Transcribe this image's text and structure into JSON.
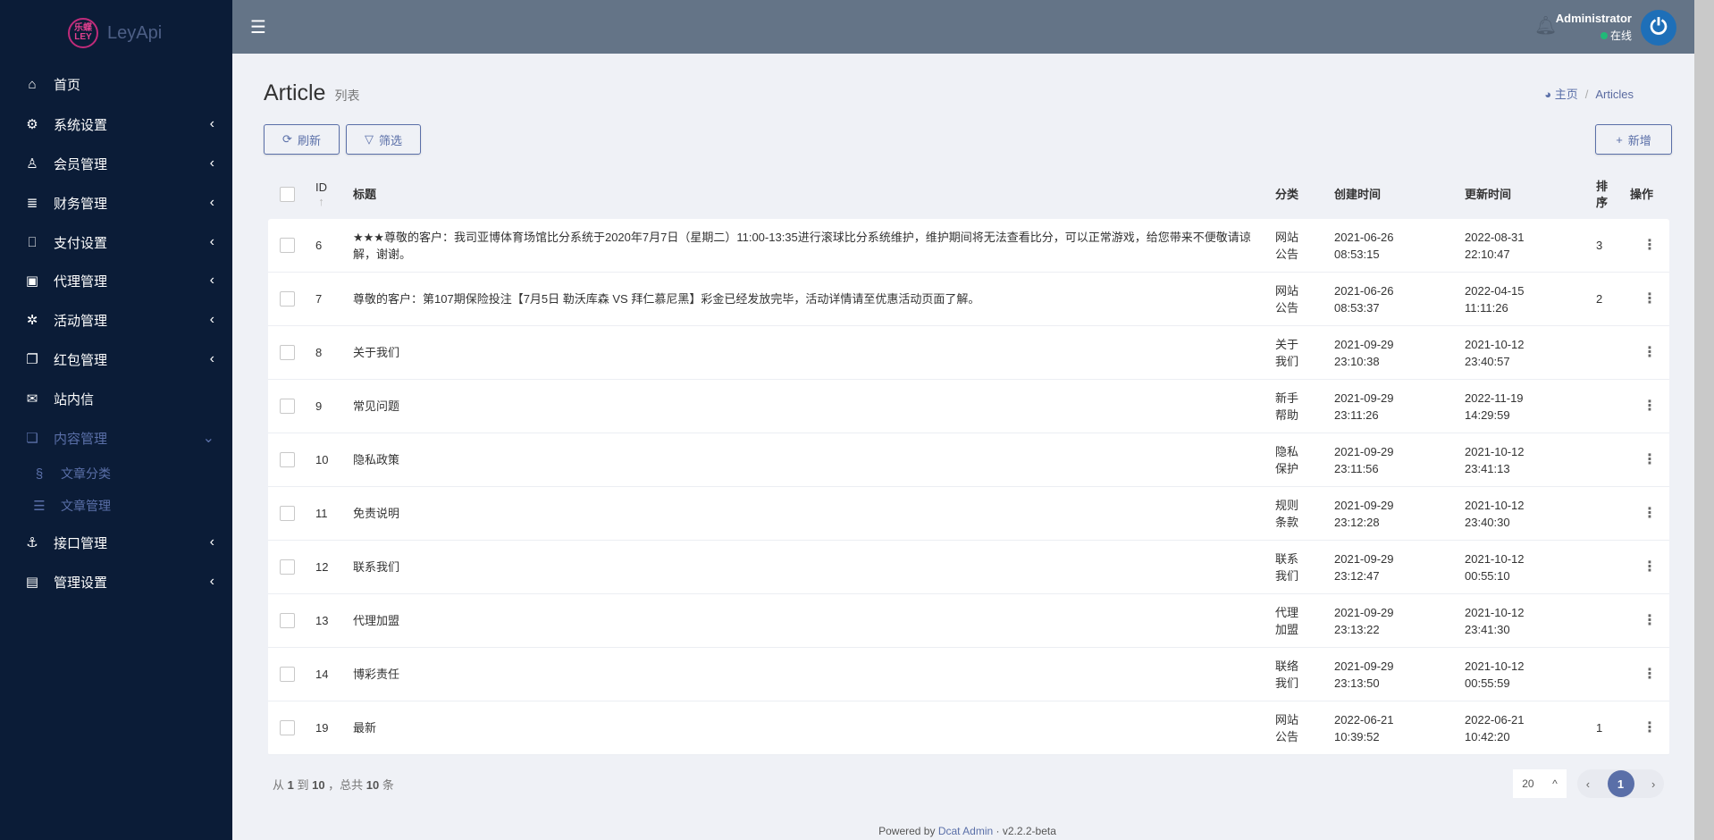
{
  "app": {
    "logo_mark": "乐蝶LEY",
    "name": "LeyApi"
  },
  "sidebar": {
    "items": [
      {
        "label": "首页",
        "icon": "home-icon",
        "glyph": "⌂",
        "chev": ""
      },
      {
        "label": "系统设置",
        "icon": "gears-icon",
        "glyph": "⚙",
        "chev": "‹"
      },
      {
        "label": "会员管理",
        "icon": "user-icon",
        "glyph": "♙",
        "chev": "‹"
      },
      {
        "label": "财务管理",
        "icon": "database-icon",
        "glyph": "≣",
        "chev": "‹"
      },
      {
        "label": "支付设置",
        "icon": "bookmark-icon",
        "glyph": "⎕",
        "chev": "‹"
      },
      {
        "label": "代理管理",
        "icon": "contact-icon",
        "glyph": "▣",
        "chev": "‹"
      },
      {
        "label": "活动管理",
        "icon": "pinwheel-icon",
        "glyph": "✲",
        "chev": "‹"
      },
      {
        "label": "红包管理",
        "icon": "clone-icon",
        "glyph": "❐",
        "chev": "‹"
      },
      {
        "label": "站内信",
        "icon": "envelope-icon",
        "glyph": "✉",
        "chev": ""
      },
      {
        "label": "内容管理",
        "icon": "copy-icon",
        "glyph": "❏",
        "chev": "⌄"
      },
      {
        "label": "文章分类",
        "icon": "category-icon",
        "glyph": "§",
        "chev": ""
      },
      {
        "label": "文章管理",
        "icon": "list-icon",
        "glyph": "☰",
        "chev": ""
      },
      {
        "label": "接口管理",
        "icon": "anchor-icon",
        "glyph": "⚓",
        "chev": "‹"
      },
      {
        "label": "管理设置",
        "icon": "id-card-icon",
        "glyph": "▤",
        "chev": "‹"
      }
    ]
  },
  "header": {
    "user_name": "Administrator",
    "status": "在线",
    "status_color": "#21b978"
  },
  "page": {
    "title": "Article",
    "subtitle": "列表",
    "breadcrumb_home": "主页",
    "breadcrumb_current": "Articles"
  },
  "toolbar": {
    "refresh": "刷新",
    "filter": "筛选",
    "create": "新增"
  },
  "table": {
    "headers": {
      "id": "ID",
      "title": "标题",
      "category": "分类",
      "created": "创建时间",
      "updated": "更新时间",
      "order": "排序",
      "actions": "操作"
    },
    "rows": [
      {
        "id": "6",
        "title": "★★★尊敬的客户：我司亚博体育场馆比分系统于2020年7月7日（星期二）11:00-13:35进行滚球比分系统维护，维护期间将无法查看比分，可以正常游戏，给您带来不便敬请谅解，谢谢。",
        "category": "网站公告",
        "created": "2021-06-26 08:53:15",
        "updated": "2022-08-31 22:10:47",
        "order": "3"
      },
      {
        "id": "7",
        "title": "尊敬的客户：第107期保险投注【7月5日 勒沃库森 VS 拜仁慕尼黑】彩金已经发放完毕，活动详情请至优惠活动页面了解。",
        "category": "网站公告",
        "created": "2021-06-26 08:53:37",
        "updated": "2022-04-15 11:11:26",
        "order": "2"
      },
      {
        "id": "8",
        "title": "关于我们",
        "category": "关于我们",
        "created": "2021-09-29 23:10:38",
        "updated": "2021-10-12 23:40:57",
        "order": ""
      },
      {
        "id": "9",
        "title": "常见问题",
        "category": "新手帮助",
        "created": "2021-09-29 23:11:26",
        "updated": "2022-11-19 14:29:59",
        "order": ""
      },
      {
        "id": "10",
        "title": "隐私政策",
        "category": "隐私保护",
        "created": "2021-09-29 23:11:56",
        "updated": "2021-10-12 23:41:13",
        "order": ""
      },
      {
        "id": "11",
        "title": "免责说明",
        "category": "规则条款",
        "created": "2021-09-29 23:12:28",
        "updated": "2021-10-12 23:40:30",
        "order": ""
      },
      {
        "id": "12",
        "title": "联系我们",
        "category": "联系我们",
        "created": "2021-09-29 23:12:47",
        "updated": "2021-10-12 00:55:10",
        "order": ""
      },
      {
        "id": "13",
        "title": "代理加盟",
        "category": "代理加盟",
        "created": "2021-09-29 23:13:22",
        "updated": "2021-10-12 23:41:30",
        "order": ""
      },
      {
        "id": "14",
        "title": "博彩责任",
        "category": "联络我们",
        "created": "2021-09-29 23:13:50",
        "updated": "2021-10-12 00:55:59",
        "order": ""
      },
      {
        "id": "19",
        "title": "最新",
        "category": "网站公告",
        "created": "2022-06-21 10:39:52",
        "updated": "2022-06-21 10:42:20",
        "order": "1"
      }
    ]
  },
  "pagination": {
    "from": "1",
    "to": "10",
    "total": "10",
    "per_page": "20",
    "current_page": "1"
  },
  "footer": {
    "powered": "Powered by",
    "brand": "Dcat Admin",
    "version": "v2.2.2-beta"
  }
}
